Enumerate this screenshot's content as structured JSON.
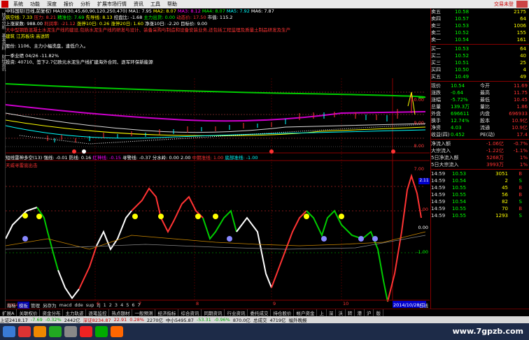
{
  "menubar": {
    "items": [
      "系统",
      "功能",
      "深度",
      "报价",
      "分析",
      "扩展市场行情",
      "资讯",
      "工具",
      "帮助"
    ],
    "brand": "交易未登"
  },
  "left_strip": {
    "labels": [
      "技术分析",
      "基本资料",
      "财经资讯"
    ]
  },
  "chart_header": {
    "title": "中科国际(日线,前复权)",
    "ma": [
      "MA10(30,45,60,90,120,250,470)",
      "MA1: 7.95",
      "MA2: 8.07",
      "MA3: 8.12",
      "MA4: 8.07",
      "MA5: 7.92",
      "MA6: 7.87"
    ],
    "line2": [
      "筑空线: 7.33",
      "压力: 8.21",
      "精准位: 7.69",
      "先导线: 8.13",
      "控盘比: -1.68",
      "主力出货: 0.00",
      "动态价: 17.50",
      "市值: 115.2"
    ],
    "line3": [
      "上涨家数: 988.00",
      "利润率: -21.12",
      "涨停10日: 0.26",
      "涨停20日: 1.60",
      "净涨10日: -2.20",
      "目标价: 9.00"
    ],
    "bio": "大中型钢筋混凝土水泥生产线的建设,包括水泥生产线的研发与设计、装备采购与制造和设备安装业务,还包括工程监理及质量土制品研发及生产",
    "tags": "建筑 江苏板块 高送转",
    "note1": "股份: 1106、主力小幅洗盘，逢低介入。",
    "note2": "一季业绩 04/26 -11.82%",
    "note3": "投资: 40710、签下2.7亿欧元水泥生产线扩建海外合同、逐军环保新能源"
  },
  "price_axis": [
    "10.00",
    "9.00",
    "8.00",
    "7.00"
  ],
  "indicator_header": {
    "name": "短线雷神多空(13)",
    "items": [
      "强线: -0.01",
      "防线: 0.16",
      "红神线: -0.15",
      "寻警线: -0.37",
      "分水岭: 0.00",
      "2.00",
      "中期准线: 1.00",
      "底部准线: -1.00"
    ],
    "sub": "天威寻雷底出击"
  },
  "indicator_axis": [
    "2.11",
    "1.00",
    "0.00",
    "-1.00"
  ],
  "date_axis": [
    "2014年",
    "6",
    "7",
    "8",
    "9",
    "10"
  ],
  "date_box": "2014/10/28/二",
  "chart_tabs": [
    "指标",
    "模板",
    "管理",
    "另存为",
    "macd",
    "dde",
    "sup",
    "zj",
    "1",
    "2",
    "3",
    "4",
    "5",
    "6",
    "7"
  ],
  "chart_tabs_right": "日线",
  "quote": {
    "ask": [
      [
        "卖五",
        "10.58",
        "2175"
      ],
      [
        "卖四",
        "10.57",
        "64"
      ],
      [
        "卖三",
        "10.53",
        "1006"
      ],
      [
        "卖二",
        "10.52",
        "155"
      ],
      [
        "卖一",
        "10.54",
        "161"
      ]
    ],
    "bid": [
      [
        "买一",
        "10.53",
        "64"
      ],
      [
        "买二",
        "10.52",
        "40"
      ],
      [
        "买三",
        "10.51",
        "25"
      ],
      [
        "买四",
        "10.50",
        "4"
      ],
      [
        "买五",
        "10.49",
        "49"
      ]
    ],
    "stats": [
      [
        "现价",
        "10.54",
        "今开",
        "11.69"
      ],
      [
        "涨跌",
        "-0.64",
        "最高",
        "11.75"
      ],
      [
        "涨幅",
        "-5.72%",
        "最低",
        "10.45"
      ],
      [
        "总量",
        "139.3万",
        "量比",
        "1.86"
      ],
      [
        "外盘",
        "696611",
        "内盘",
        "696933"
      ],
      [
        "换手",
        "12.74%",
        "股本",
        "10.9亿"
      ],
      [
        "净资",
        "4.03",
        "流通",
        "10.9亿"
      ],
      [
        "收益(四)",
        "0.452",
        "PE(动)",
        "17.4"
      ]
    ],
    "flow": [
      [
        "净流入额",
        "-1.06亿",
        "-0.7%"
      ],
      [
        "大宗流入",
        "-1.22亿",
        "-1.1%"
      ],
      [
        "5日净流入额",
        "5268万",
        "1%"
      ],
      [
        "5日大宗流入",
        "3993万",
        "1%"
      ]
    ],
    "ticks": [
      [
        "14:59",
        "10.53",
        "3051",
        "B"
      ],
      [
        "14:59",
        "10.54",
        "2",
        "S"
      ],
      [
        "14:59",
        "10.55",
        "45",
        "B"
      ],
      [
        "14:59",
        "10.55",
        "56",
        "B"
      ],
      [
        "14:59",
        "10.54",
        "82",
        "S"
      ],
      [
        "14:59",
        "10.55",
        "70",
        "B"
      ],
      [
        "14:59",
        "10.55",
        "1293",
        "S"
      ]
    ]
  },
  "bottom_tabs": [
    "扩展A",
    "关联权价",
    "资金分布",
    "主力轨迹",
    "逐笔监控",
    "热点题材",
    "一般预测",
    "经济指标",
    "综合资讯",
    "同期资讯",
    "行业资讯",
    "委托成交",
    "持仓股价",
    "帐户资金",
    "上",
    "深",
    "沃",
    "转",
    "港",
    "沪",
    "版"
  ],
  "statusbar": {
    "items": [
      "上证2418.17",
      "-7.69",
      "-0.32%",
      "2442亿",
      "深证8234.87",
      "22.91",
      "0.28%",
      "2270亿",
      "中小5495.87",
      "-53.31",
      "-0.96%",
      "870.0亿",
      "总成交",
      "4719亿",
      "福外晚报"
    ]
  },
  "watermark": "www.7gpzb.com"
}
